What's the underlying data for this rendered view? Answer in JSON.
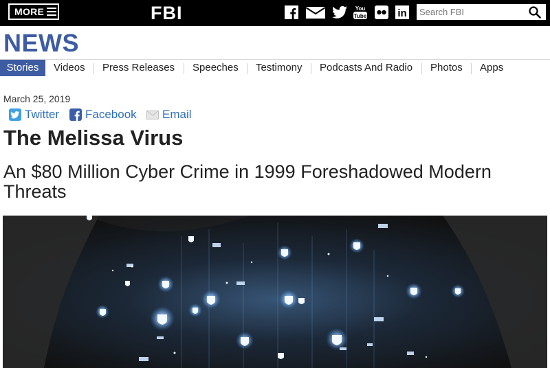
{
  "header": {
    "more_label": "MORE",
    "logo_text": "FBI",
    "social_icons": [
      "facebook-icon",
      "email-icon",
      "twitter-icon",
      "youtube-icon",
      "flickr-icon",
      "linkedin-icon"
    ],
    "youtube_text_top": "You",
    "youtube_text_bottom": "Tube",
    "linkedin_text": "in",
    "search_placeholder": "Search FBI"
  },
  "section": {
    "title": "NEWS",
    "accent_color": "#3e5ca3"
  },
  "nav": {
    "items": [
      {
        "label": "Stories",
        "active": true
      },
      {
        "label": "Videos"
      },
      {
        "label": "Press Releases"
      },
      {
        "label": "Speeches"
      },
      {
        "label": "Testimony"
      },
      {
        "label": "Podcasts And Radio"
      },
      {
        "label": "Photos"
      },
      {
        "label": "Apps"
      }
    ]
  },
  "article": {
    "date": "March 25, 2019",
    "share": {
      "twitter": "Twitter",
      "facebook": "Facebook",
      "email": "Email"
    },
    "title": "The Melissa Virus",
    "subtitle": "An $80 Million Cyber Crime in 1999 Foreshadowed Modern Threats",
    "hero_image": "person-with-glowing-digital-lock-icons"
  }
}
